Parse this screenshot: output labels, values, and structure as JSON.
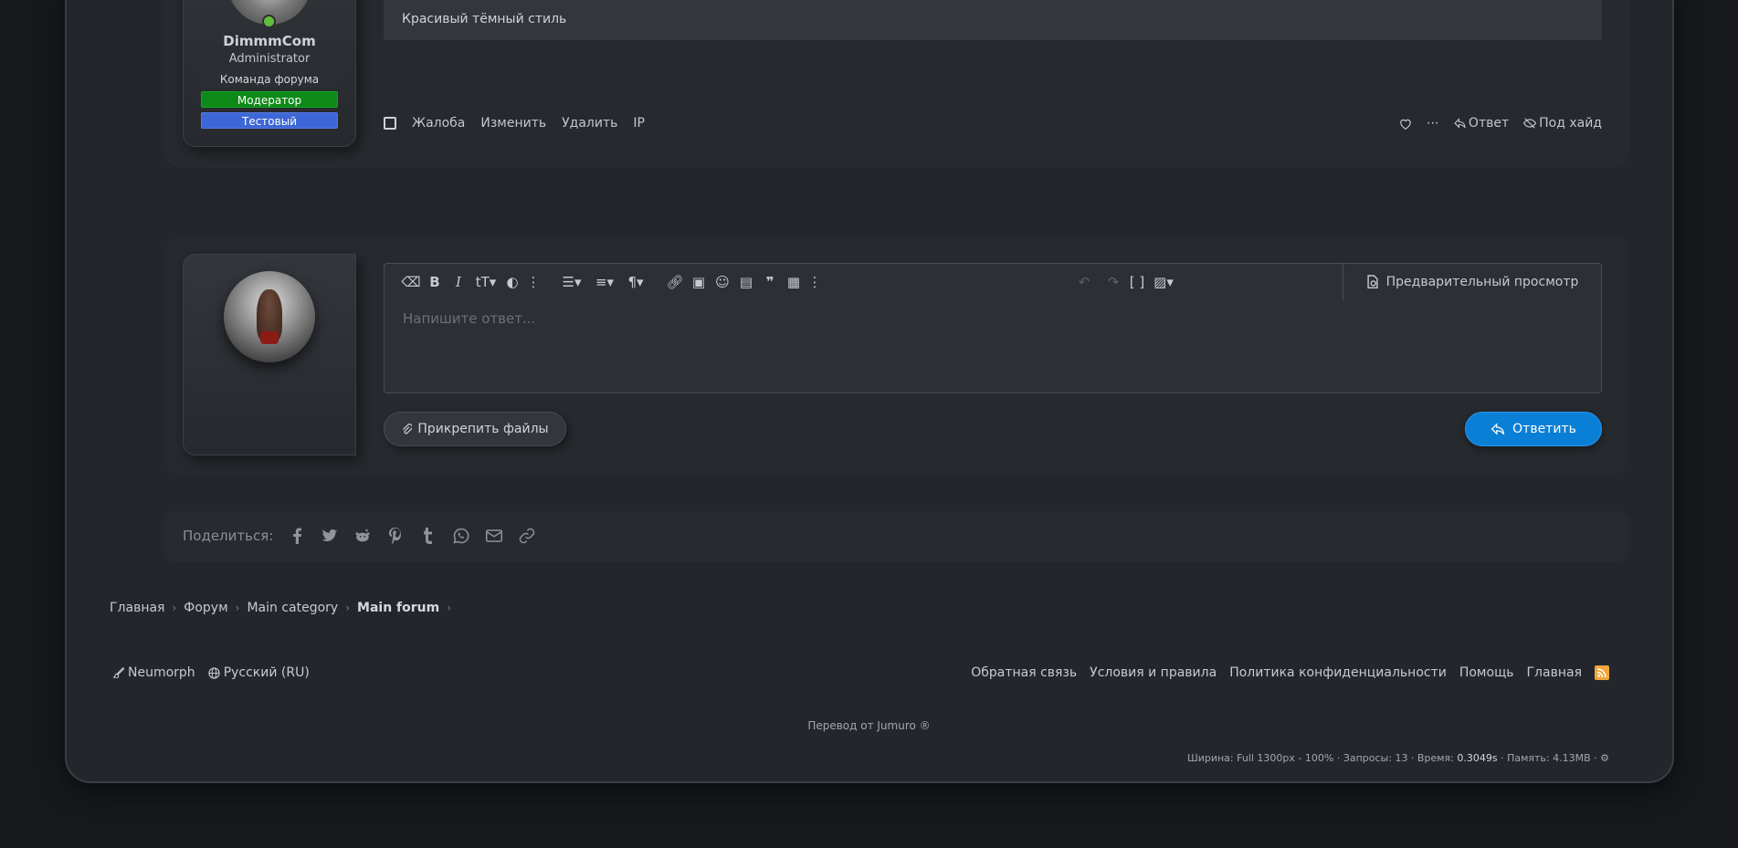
{
  "post": {
    "username": "DimmmCom",
    "user_title": "Administrator",
    "badges": [
      "Команда форума",
      "Модератор",
      "Тестовый"
    ],
    "signature": "Красивый тёмный стиль",
    "actions": [
      "Жалоба",
      "Изменить",
      "Удалить",
      "IP"
    ],
    "reply_label": "Ответ",
    "hide_label": "Под хайд"
  },
  "editor": {
    "placeholder": "Напишите ответ...",
    "preview_label": "Предварительный просмотр",
    "attach_label": "Прикрепить файлы",
    "submit_label": "Ответить"
  },
  "share": {
    "label": "Поделиться:",
    "icons": [
      "facebook-icon",
      "twitter-icon",
      "reddit-icon",
      "pinterest-icon",
      "tumblr-icon",
      "whatsapp-icon",
      "email-icon",
      "link-icon"
    ]
  },
  "breadcrumb": [
    "Главная",
    "Форум",
    "Main category",
    "Main forum"
  ],
  "footer": {
    "style_label": "Neumorph",
    "language_label": "Русский (RU)",
    "links": [
      "Обратная связь",
      "Условия и правила",
      "Политика конфиденциальности",
      "Помощь",
      "Главная"
    ],
    "translation": "Перевод от Jumuro ®",
    "debug_prefix": "Ширина: Full 1300px - 100% · Запросы: 13 · Время: ",
    "debug_time": "0.3049s",
    "debug_suffix": " · Память: 4.13MB ·"
  },
  "colors": {
    "primary": "#0a7fd6",
    "moderator_badge": "#0d8a17",
    "test_badge": "#3d66d6",
    "online": "#5fbf3a",
    "rss": "#f2a63a"
  }
}
